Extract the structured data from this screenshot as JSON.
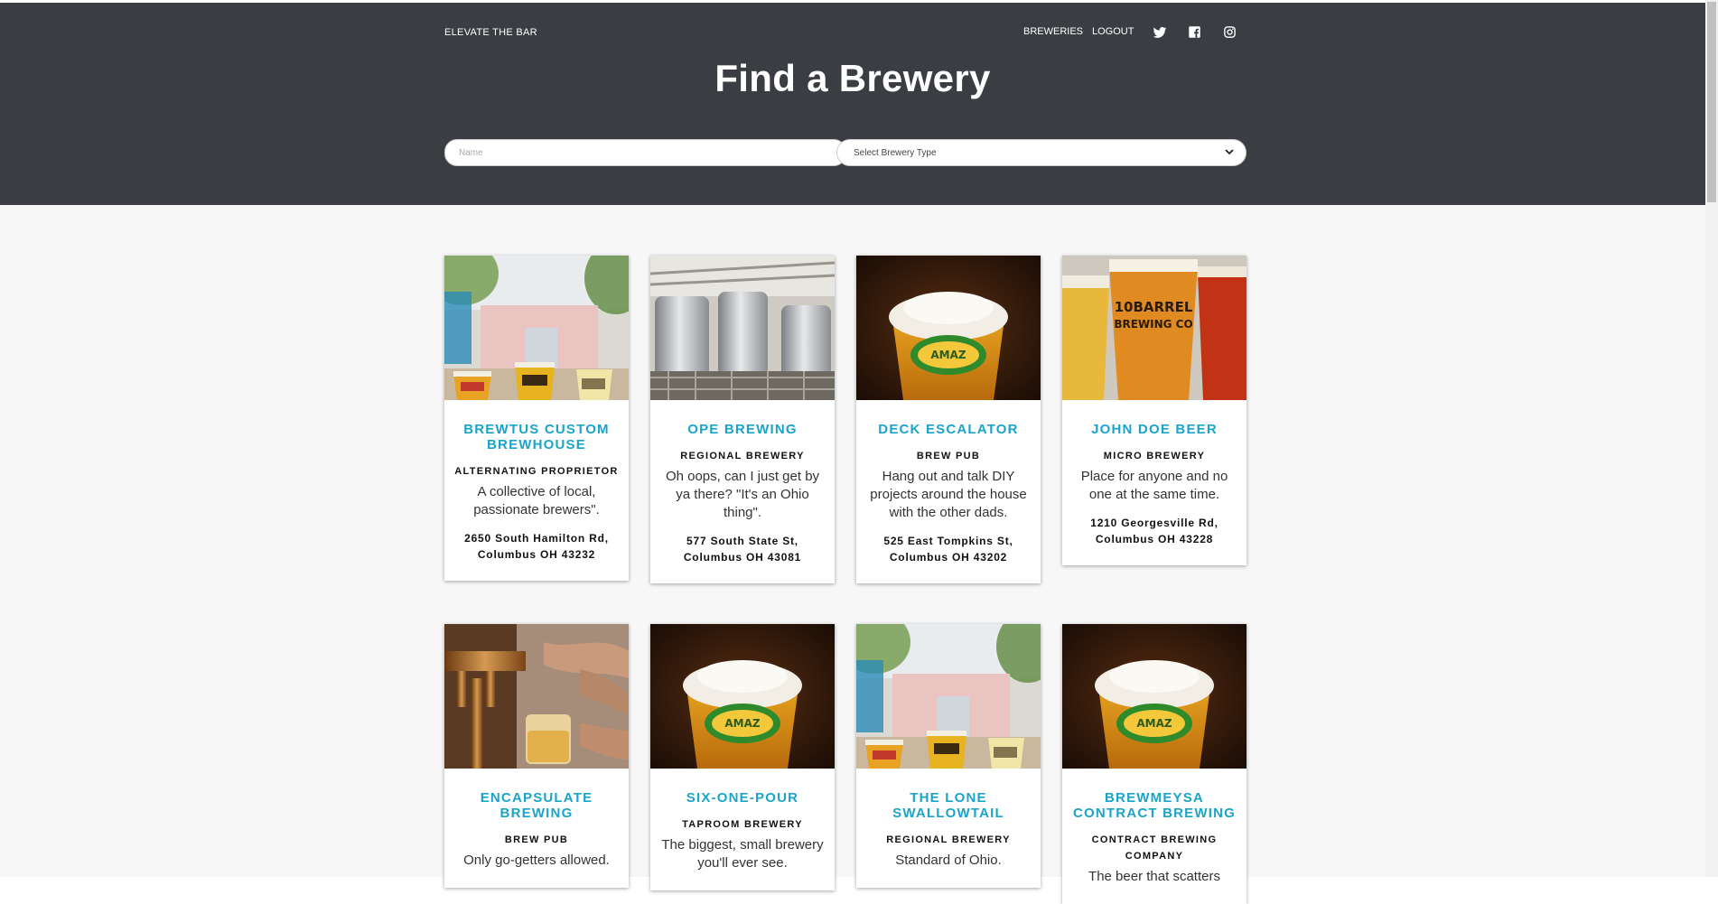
{
  "nav": {
    "brand": "ELEVATE THE BAR",
    "breweries": "BREWERIES",
    "logout": "LOGOUT",
    "social_icons": [
      "twitter-icon",
      "facebook-icon",
      "instagram-icon"
    ]
  },
  "hero": {
    "title": "Find a Brewery"
  },
  "search": {
    "name_placeholder": "Name",
    "type_selected": "Select Brewery Type"
  },
  "colors": {
    "header_bg": "#3a3d41",
    "accent": "#1aa4c9",
    "page_bg": "#f7f7f7"
  },
  "breweries": [
    {
      "name": "BREWTUS CUSTOM BREWHOUSE",
      "type": "ALTERNATING PROPRIETOR",
      "description": "A collective of local, passionate brewers\".",
      "address": "2650 South Hamilton Rd, Columbus OH 43232",
      "image": "veza-sur-storefront"
    },
    {
      "name": "OPE BREWING",
      "type": "REGIONAL BREWERY",
      "description": "Oh oops, can I just get by ya there? \"It's an Ohio thing\".",
      "address": "577 South State St, Columbus OH 43081",
      "image": "brewhouse-tanks"
    },
    {
      "name": "DECK ESCALATOR",
      "type": "BREW PUB",
      "description": "Hang out and talk DIY projects around the house with the other dads.",
      "address": "525 East Tompkins St, Columbus OH 43202",
      "image": "amazon-beer-glass"
    },
    {
      "name": "JOHN DOE BEER",
      "type": "MICRO BREWERY",
      "description": "Place for anyone and no one at the same time.",
      "address": "1210 Georgesville Rd, Columbus OH 43228",
      "image": "10-barrel-flight"
    },
    {
      "name": "ENCAPSULATE BREWING",
      "type": "BREW PUB",
      "description": "Only go-getters allowed.",
      "address": "",
      "image": "tap-pour"
    },
    {
      "name": "SIX-ONE-POUR",
      "type": "TAPROOM BREWERY",
      "description": "The biggest, small brewery you'll ever see.",
      "address": "",
      "image": "amazon-beer-glass"
    },
    {
      "name": "THE LONE SWALLOWTAIL",
      "type": "REGIONAL BREWERY",
      "description": "Standard of Ohio.",
      "address": "",
      "image": "veza-sur-storefront"
    },
    {
      "name": "BREWMEYSA CONTRACT BREWING",
      "type": "CONTRACT BREWING COMPANY",
      "description": "The beer that scatters",
      "address": "",
      "image": "amazon-beer-glass"
    }
  ]
}
